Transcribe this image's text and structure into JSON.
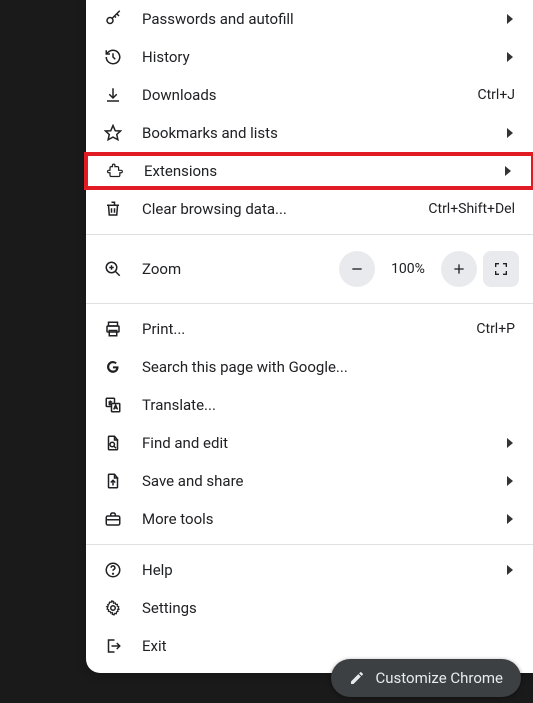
{
  "menu": {
    "sections": [
      [
        {
          "icon": "key-icon",
          "label": "Passwords and autofill",
          "submenu": true
        },
        {
          "icon": "history-icon",
          "label": "History",
          "submenu": true
        },
        {
          "icon": "download-icon",
          "label": "Downloads",
          "shortcut": "Ctrl+J"
        },
        {
          "icon": "star-icon",
          "label": "Bookmarks and lists",
          "submenu": true
        },
        {
          "icon": "extension-icon",
          "label": "Extensions",
          "submenu": true,
          "highlighted": true
        },
        {
          "icon": "trash-icon",
          "label": "Clear browsing data...",
          "shortcut": "Ctrl+Shift+Del"
        }
      ],
      [
        {
          "type": "zoom",
          "icon": "zoom-in-icon",
          "label": "Zoom",
          "value": "100%"
        }
      ],
      [
        {
          "icon": "print-icon",
          "label": "Print...",
          "shortcut": "Ctrl+P"
        },
        {
          "icon": "google-icon",
          "label": "Search this page with Google..."
        },
        {
          "icon": "translate-icon",
          "label": "Translate..."
        },
        {
          "icon": "find-icon",
          "label": "Find and edit",
          "submenu": true
        },
        {
          "icon": "share-icon",
          "label": "Save and share",
          "submenu": true
        },
        {
          "icon": "toolbox-icon",
          "label": "More tools",
          "submenu": true
        }
      ],
      [
        {
          "icon": "help-icon",
          "label": "Help",
          "submenu": true
        },
        {
          "icon": "settings-icon",
          "label": "Settings"
        },
        {
          "icon": "exit-icon",
          "label": "Exit"
        }
      ]
    ]
  },
  "customize_button": "Customize Chrome"
}
